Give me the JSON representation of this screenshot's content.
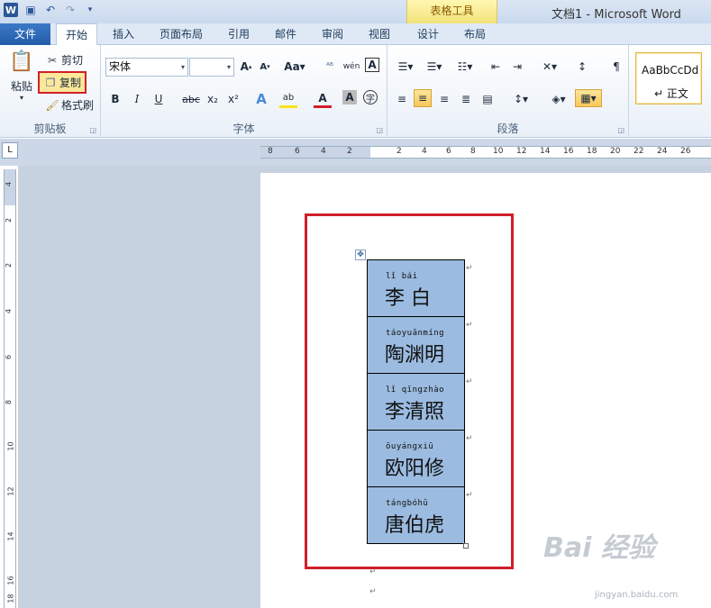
{
  "title_bar": {
    "window_title": "文档1 - Microsoft Word",
    "context_tab_group": "表格工具",
    "qat_icons": [
      "word-logo-icon",
      "save-icon",
      "undo-icon",
      "redo-icon",
      "customize-icon"
    ]
  },
  "tabs": [
    "文件",
    "开始",
    "插入",
    "页面布局",
    "引用",
    "邮件",
    "审阅",
    "视图",
    "设计",
    "布局"
  ],
  "active_tab": "开始",
  "ribbon": {
    "clipboard": {
      "label": "剪贴板",
      "paste": "粘贴",
      "cut": "剪切",
      "copy": "复制",
      "format_painter": "格式刷"
    },
    "font": {
      "label": "字体",
      "font_name": "宋体",
      "font_size": "",
      "buttons": [
        "B",
        "I",
        "U",
        "abc",
        "x₂",
        "x²"
      ]
    },
    "paragraph": {
      "label": "段落"
    },
    "styles": {
      "sample": "AaBbCcDd",
      "name": "↵ 正文"
    }
  },
  "ruler": {
    "h_numbers": [
      "8",
      "6",
      "4",
      "2",
      "2",
      "4",
      "6",
      "8",
      "10",
      "12",
      "14",
      "16",
      "18",
      "20",
      "22",
      "24",
      "26"
    ],
    "v_numbers": [
      "4",
      "2",
      "2",
      "4",
      "6",
      "8",
      "10",
      "12",
      "14",
      "16",
      "18"
    ]
  },
  "document": {
    "table_rows": [
      {
        "pinyin": "lǐ      bái",
        "hanzi": "李  白"
      },
      {
        "pinyin": "táoyuānmíng",
        "hanzi": "陶渊明"
      },
      {
        "pinyin": "lǐ qīngzhào",
        "hanzi": "李清照"
      },
      {
        "pinyin": "ōuyángxiū",
        "hanzi": "欧阳修"
      },
      {
        "pinyin": "tángbóhǔ",
        "hanzi": "唐伯虎"
      }
    ],
    "return_mark": "↵"
  },
  "watermark": {
    "main": "Bai 经验",
    "sub": "jingyan.baidu.com"
  }
}
